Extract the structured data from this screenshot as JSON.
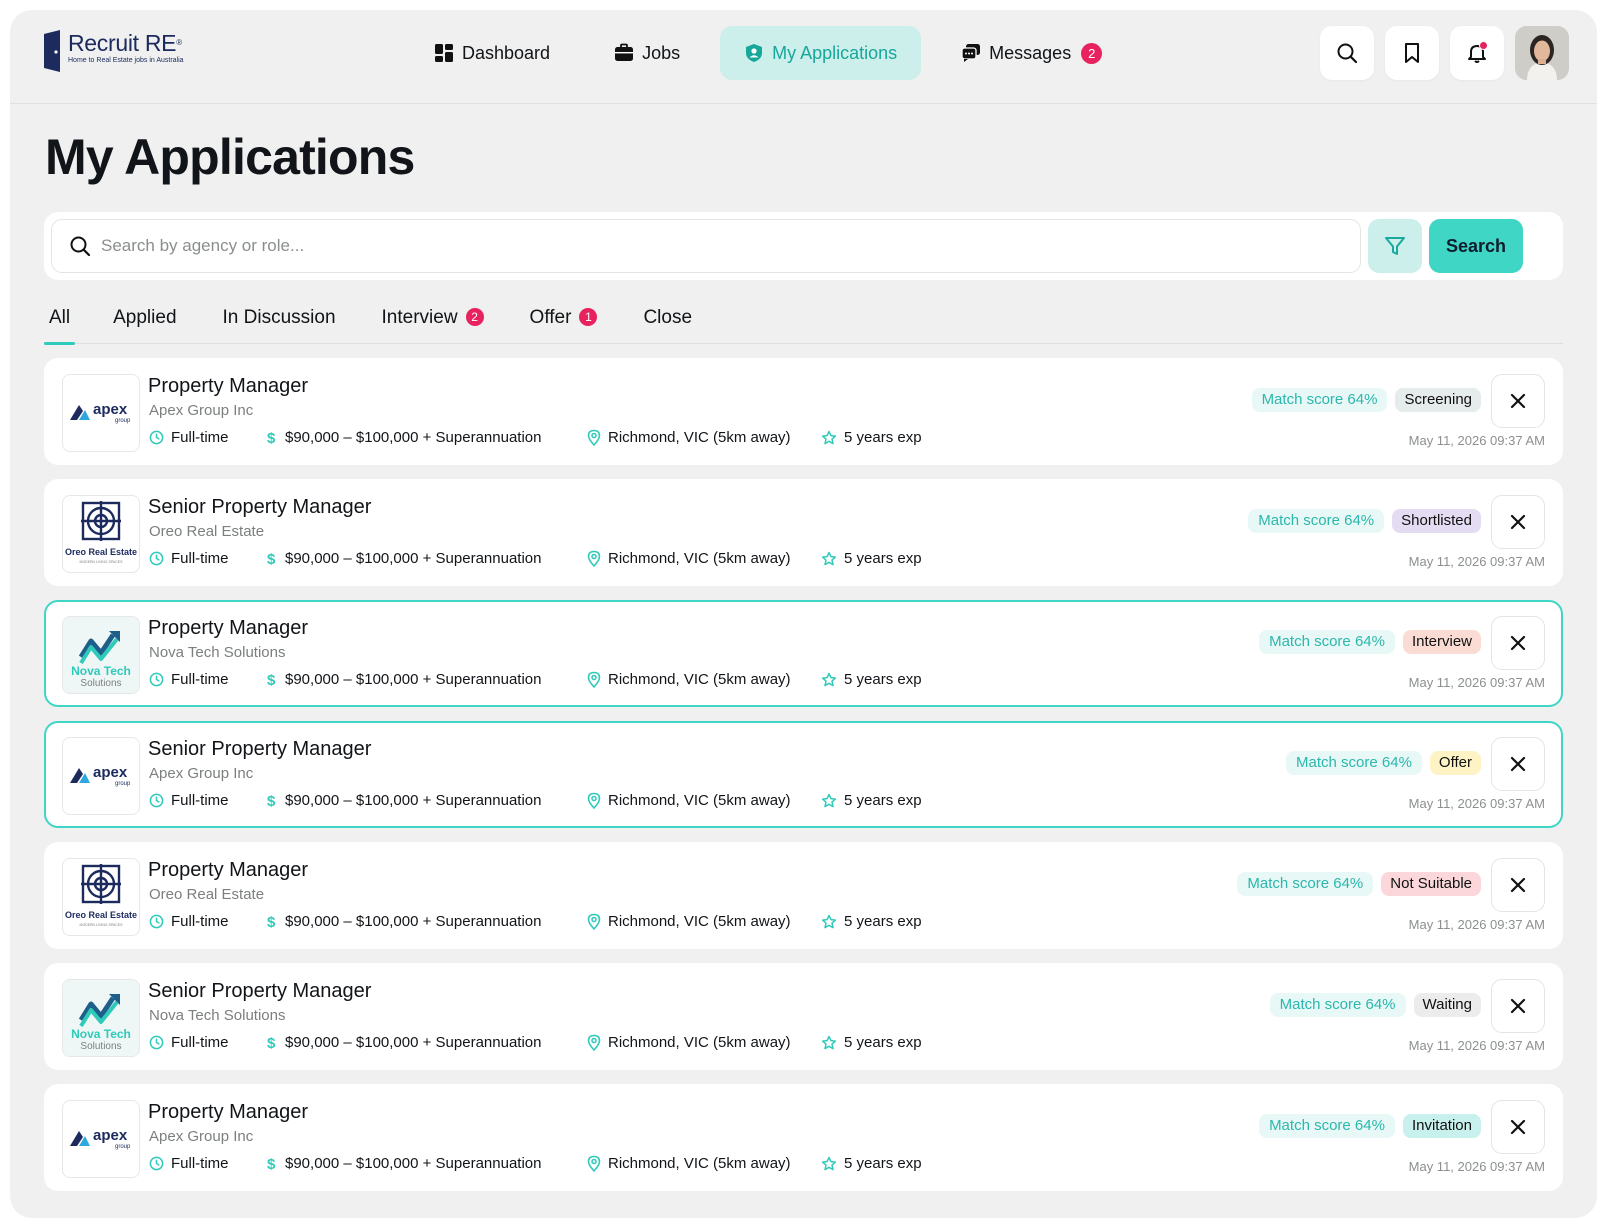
{
  "app": {
    "brand": "Recruit RE",
    "brand_mark": "®",
    "tagline": "Home to Real Estate jobs in Australia"
  },
  "nav": {
    "items": [
      {
        "label": "Dashboard",
        "icon": "grid-icon"
      },
      {
        "label": "Jobs",
        "icon": "briefcase-icon"
      },
      {
        "label": "My Applications",
        "icon": "user-shield-icon",
        "active": true
      },
      {
        "label": "Messages",
        "icon": "chat-icon",
        "badge": "2"
      }
    ]
  },
  "tools": {
    "search_icon": "search-icon",
    "bookmark_icon": "bookmark-icon",
    "notification_icon": "bell-icon",
    "avatar": "user-avatar"
  },
  "page": {
    "title": "My Applications"
  },
  "search": {
    "placeholder": "Search by agency or role...",
    "value": "",
    "button_label": "Search"
  },
  "tabs": [
    {
      "label": "All",
      "active": true,
      "badge": ""
    },
    {
      "label": "Applied",
      "badge": ""
    },
    {
      "label": "In Discussion",
      "badge": ""
    },
    {
      "label": "Interview",
      "badge": "2"
    },
    {
      "label": "Offer",
      "badge": "1"
    },
    {
      "label": "Close",
      "badge": ""
    }
  ],
  "colors": {
    "accent": "#3fd6c6",
    "accent_soft": "#ccefec",
    "badge_red": "#e8225f",
    "brand_navy": "#1c2a5e"
  },
  "applications": [
    {
      "title": "Property Manager",
      "company": "Apex Group Inc",
      "logo": "apex",
      "logo_text": "apex",
      "logo_sub": "group",
      "type": "Full-time",
      "salary": "$90,000 – $100,000 + Superannuation",
      "location": "Richmond, VIC (5km away)",
      "experience": "5 years exp",
      "match": "Match score 64%",
      "status": "Screening",
      "status_color": "#e6eceb",
      "date": "May 11, 2026 09:37 AM",
      "highlight": false
    },
    {
      "title": "Senior Property Manager",
      "company": "Oreo Real Estate",
      "logo": "oreo",
      "logo_text": "Oreo Real Estate",
      "logo_sub": "MODERN LIVING SPACES",
      "type": "Full-time",
      "salary": "$90,000 – $100,000 + Superannuation",
      "location": "Richmond, VIC (5km away)",
      "experience": "5 years exp",
      "match": "Match score 64%",
      "status": "Shortlisted",
      "status_color": "#e4dcf3",
      "date": "May 11, 2026 09:37 AM",
      "highlight": false
    },
    {
      "title": "Property Manager",
      "company": "Nova Tech Solutions",
      "logo": "nova",
      "logo_text": "Nova Tech",
      "logo_sub": "Solutions",
      "type": "Full-time",
      "salary": "$90,000 – $100,000 + Superannuation",
      "location": "Richmond, VIC (5km away)",
      "experience": "5 years exp",
      "match": "Match score 64%",
      "status": "Interview",
      "status_color": "#fbdcd4",
      "date": "May 11, 2026 09:37 AM",
      "highlight": true
    },
    {
      "title": "Senior Property Manager",
      "company": "Apex Group Inc",
      "logo": "apex",
      "logo_text": "apex",
      "logo_sub": "group",
      "type": "Full-time",
      "salary": "$90,000 – $100,000 + Superannuation",
      "location": "Richmond, VIC (5km away)",
      "experience": "5 years exp",
      "match": "Match score 64%",
      "status": "Offer",
      "status_color": "#fdf3c4",
      "date": "May 11, 2026 09:37 AM",
      "highlight": true
    },
    {
      "title": "Property Manager",
      "company": "Oreo Real Estate",
      "logo": "oreo",
      "logo_text": "Oreo Real Estate",
      "logo_sub": "MODERN LIVING SPACES",
      "type": "Full-time",
      "salary": "$90,000 – $100,000 + Superannuation",
      "location": "Richmond, VIC (5km away)",
      "experience": "5 years exp",
      "match": "Match score 64%",
      "status": "Not Suitable",
      "status_color": "#fbd7db",
      "date": "May 11, 2026 09:37 AM",
      "highlight": false
    },
    {
      "title": "Senior Property Manager",
      "company": "Nova Tech Solutions",
      "logo": "nova",
      "logo_text": "Nova Tech",
      "logo_sub": "Solutions",
      "type": "Full-time",
      "salary": "$90,000 – $100,000 + Superannuation",
      "location": "Richmond, VIC (5km away)",
      "experience": "5 years exp",
      "match": "Match score 64%",
      "status": "Waiting",
      "status_color": "#ececec",
      "date": "May 11, 2026 09:37 AM",
      "highlight": false
    },
    {
      "title": "Property Manager",
      "company": "Apex Group Inc",
      "logo": "apex",
      "logo_text": "apex",
      "logo_sub": "group",
      "type": "Full-time",
      "salary": "$90,000 – $100,000 + Superannuation",
      "location": "Richmond, VIC (5km away)",
      "experience": "5 years exp",
      "match": "Match score 64%",
      "status": "Invitation",
      "status_color": "#c8f0ec",
      "date": "May 11, 2026 09:37 AM",
      "highlight": false
    }
  ]
}
